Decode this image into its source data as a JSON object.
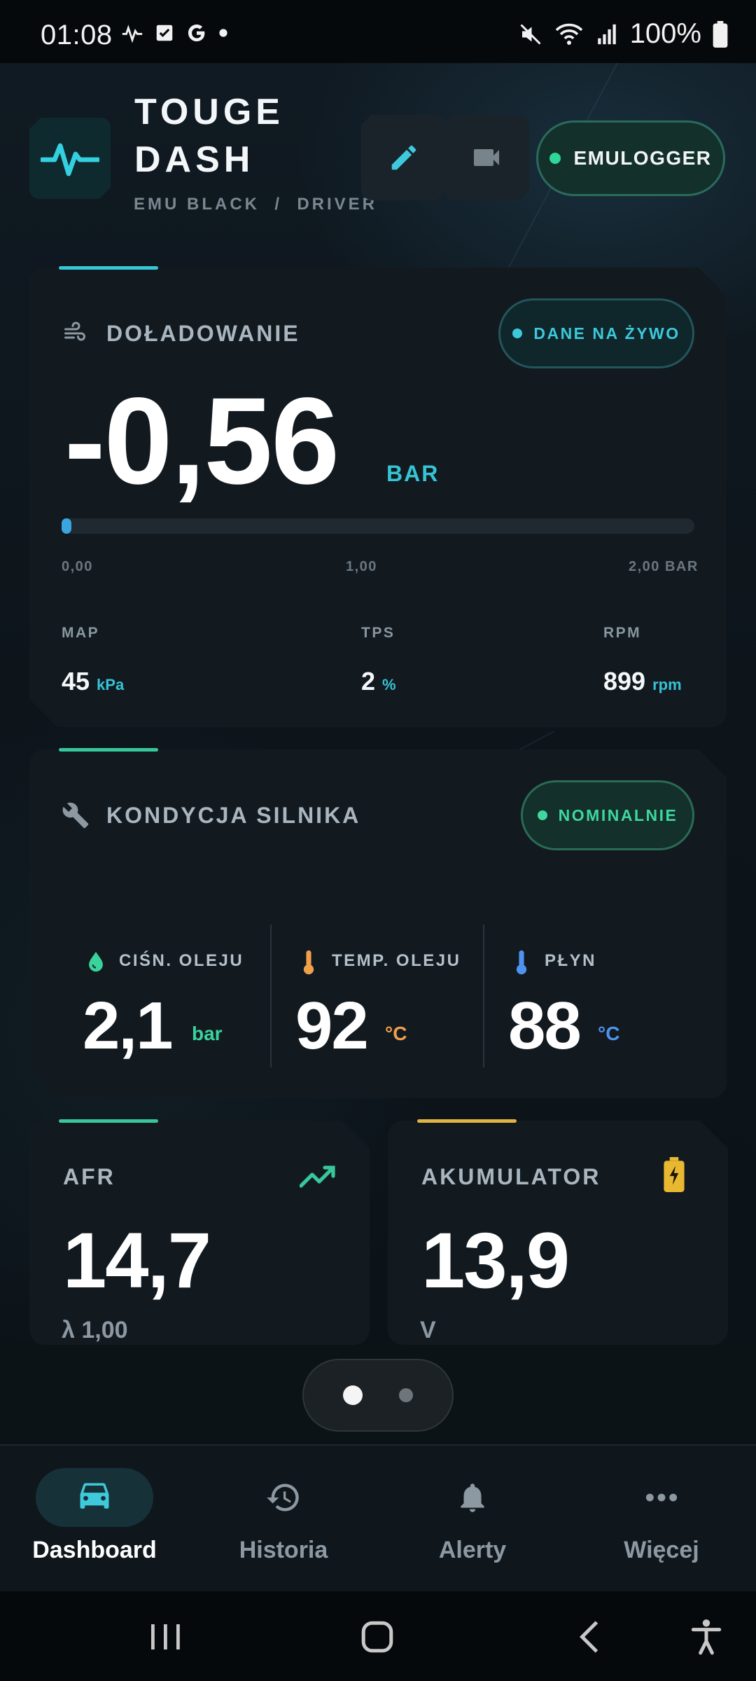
{
  "status_bar": {
    "time": "01:08",
    "left_icons": [
      "activity-icon",
      "checkbox-icon",
      "google-icon",
      "notification-dot"
    ],
    "right_icons": [
      "mute-icon",
      "wifi-icon",
      "signal-icon",
      "battery-icon"
    ],
    "battery": "100%"
  },
  "header": {
    "title_line1": "TOUGE",
    "title_line2": "DASH",
    "subtitle": "EMU BLACK  /  DRIVER",
    "logo_icon": "pulse-icon",
    "edit_icon": "pencil-icon",
    "camera_icon": "video-camera-icon",
    "emulogger": {
      "label": "EMULOGGER",
      "status_color": "#2fd69a"
    }
  },
  "boost_card": {
    "title": "DOŁADOWANIE",
    "icon": "wind-icon",
    "live_badge": "DANE NA ŻYWO",
    "value": "-0,56",
    "unit": "BAR",
    "progress_fraction": 0.0,
    "scale": {
      "min": "0,00",
      "mid": "1,00",
      "max": "2,00 BAR"
    },
    "metrics": [
      {
        "label": "MAP",
        "value": "45",
        "unit": "kPa"
      },
      {
        "label": "TPS",
        "value": "2",
        "unit": "%"
      },
      {
        "label": "RPM",
        "value": "899",
        "unit": "rpm"
      }
    ],
    "accent_color": "#34c6d6"
  },
  "engine_card": {
    "title": "KONDYCJA SILNIKA",
    "icon": "wrench-icon",
    "status_badge": "NOMINALNIE",
    "accent_color": "#37c79a",
    "gauges": [
      {
        "label": "CIŚN. OLEJU",
        "value": "2,1",
        "unit": "bar",
        "icon": "oil-drop-icon",
        "color": "#3ad39c"
      },
      {
        "label": "TEMP. OLEJU",
        "value": "92",
        "unit": "°C",
        "icon": "thermometer-icon",
        "color": "#f0a04a"
      },
      {
        "label": "PŁYN",
        "value": "88",
        "unit": "°C",
        "icon": "thermometer-icon",
        "color": "#4f93f0"
      }
    ]
  },
  "afr_card": {
    "title": "AFR",
    "value": "14,7",
    "sub": "λ 1,00",
    "icon": "trend-up-icon",
    "accent_color": "#37c79a"
  },
  "battery_card": {
    "title": "AKUMULATOR",
    "value": "13,9",
    "sub": "V",
    "icon": "battery-charging-icon",
    "accent_color": "#e0b442"
  },
  "pager": {
    "pages": 2,
    "active": 0
  },
  "bottom_nav": [
    {
      "label": "Dashboard",
      "icon": "car-icon",
      "active": true
    },
    {
      "label": "Historia",
      "icon": "history-icon",
      "active": false
    },
    {
      "label": "Alerty",
      "icon": "bell-icon",
      "active": false
    },
    {
      "label": "Więcej",
      "icon": "more-icon",
      "active": false
    }
  ],
  "system_nav": [
    "recent-apps-icon",
    "home-icon",
    "back-icon",
    "accessibility-icon"
  ]
}
